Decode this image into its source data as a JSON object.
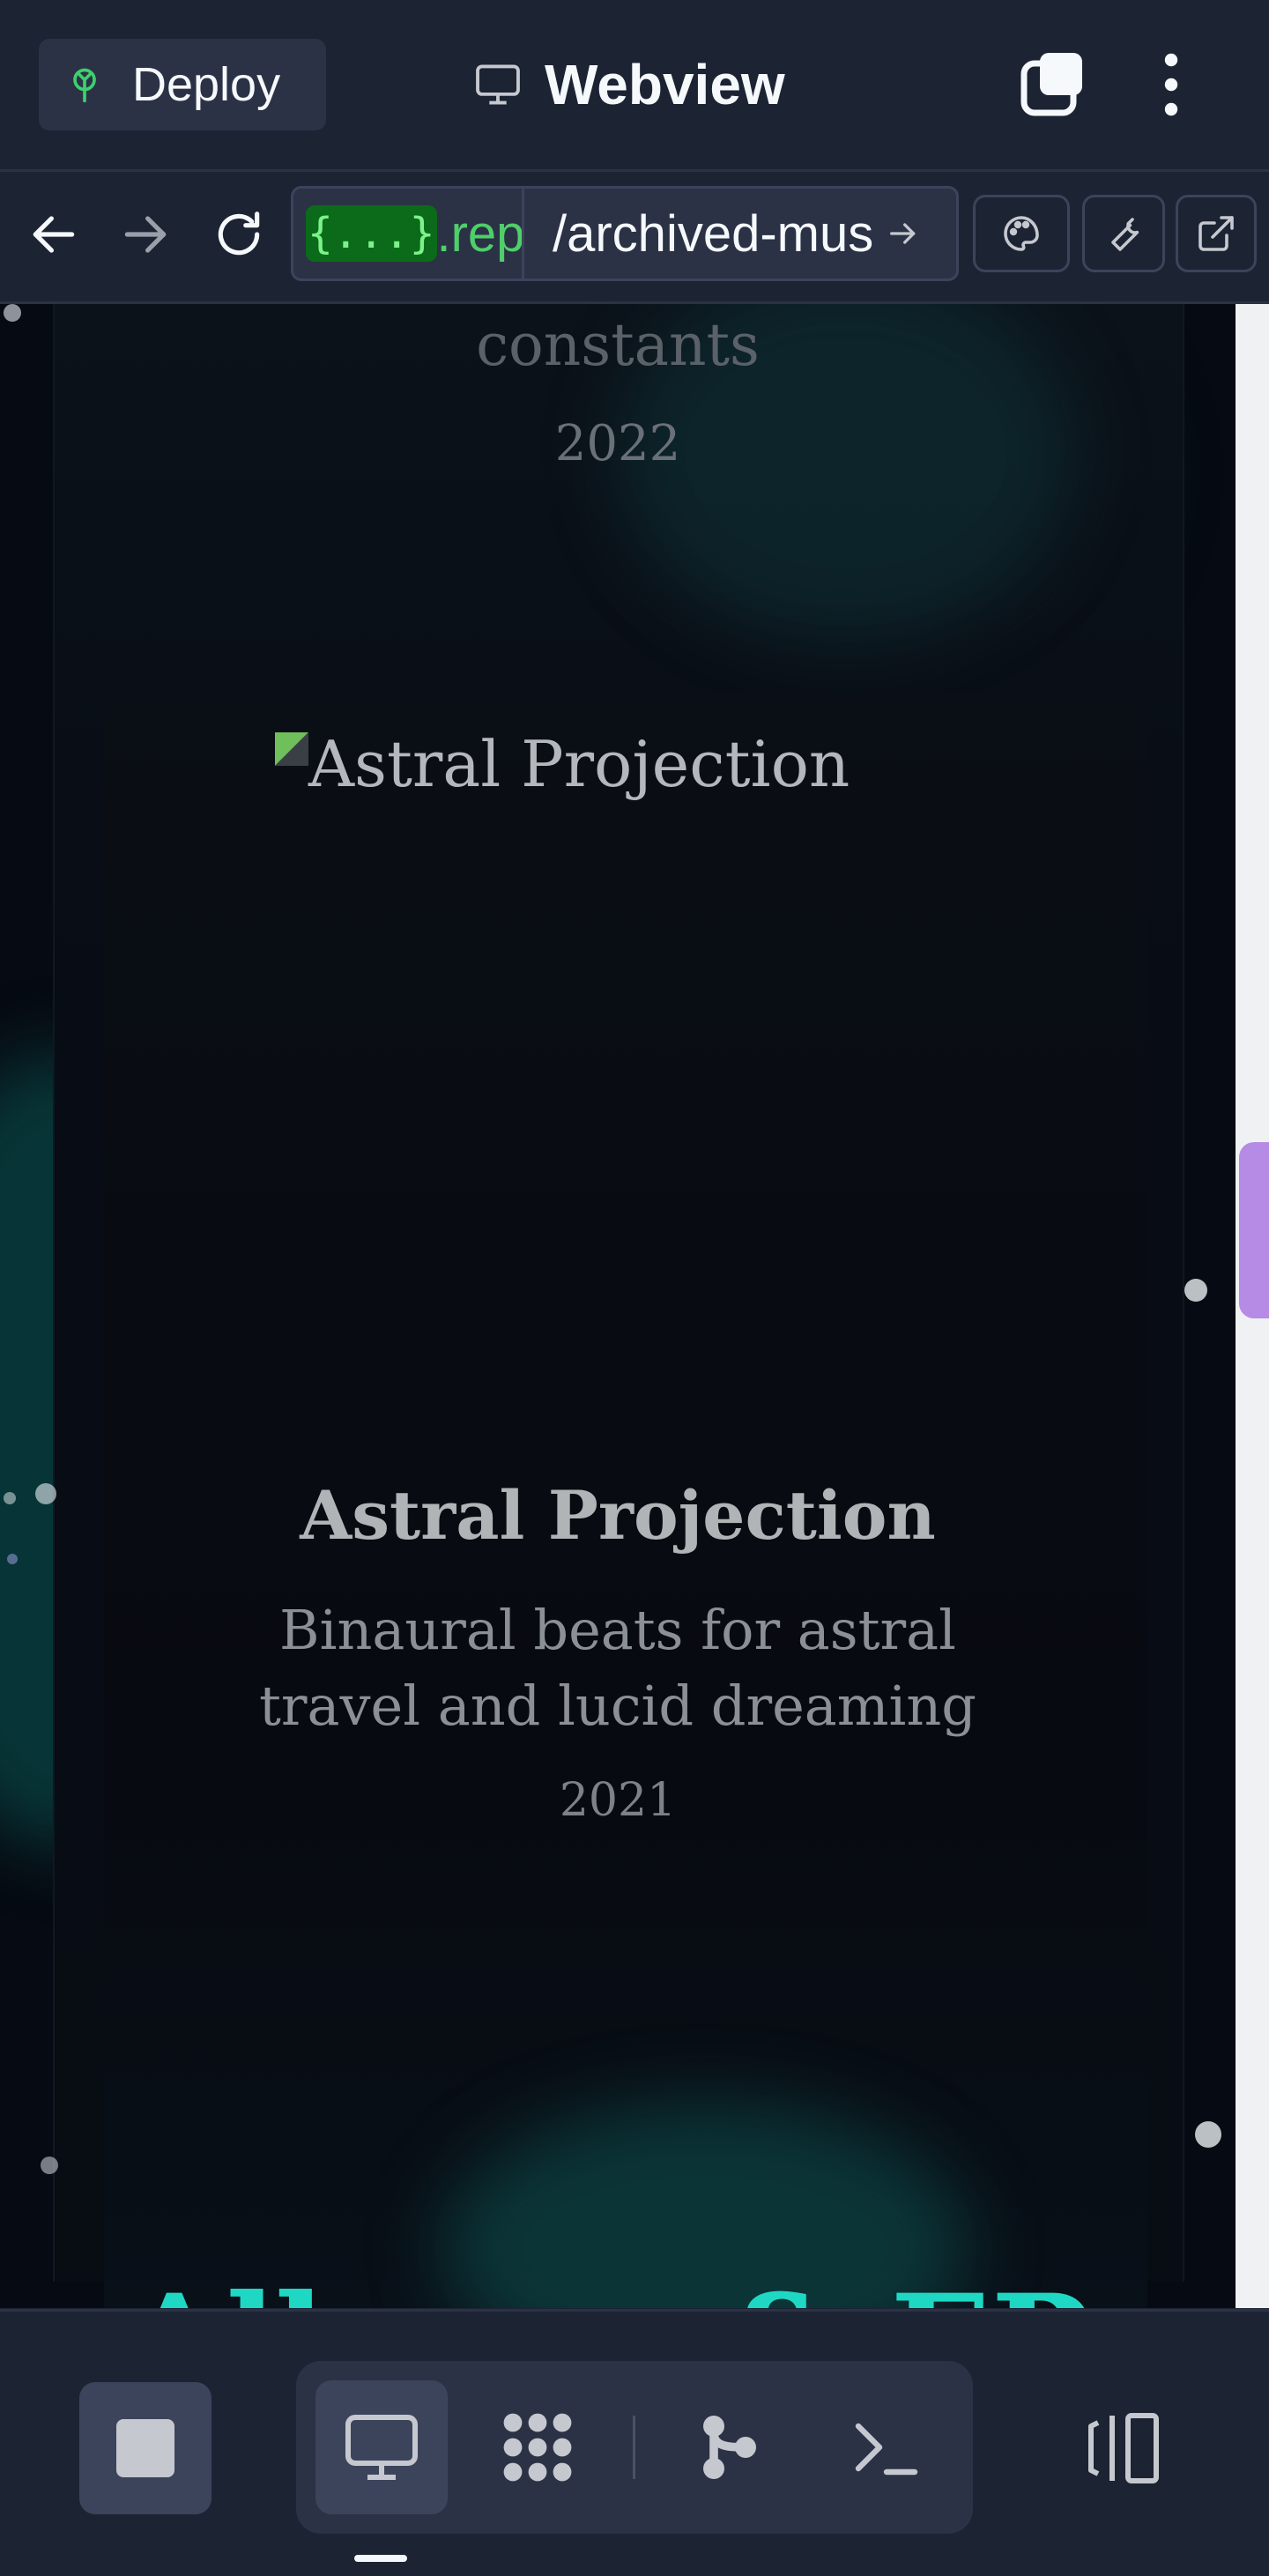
{
  "header": {
    "deploy_label": "Deploy",
    "title": "Webview"
  },
  "urlbar": {
    "badge": "{...}",
    "host": ".repl",
    "path": "/archived-mus"
  },
  "content": {
    "previous_item": {
      "title_fragment": "constants",
      "year": "2022"
    },
    "card": {
      "image_alt": "Astral Projection",
      "title": "Astral Projection",
      "description": "Binaural beats for astral travel and lucid dreaming",
      "year": "2021"
    },
    "next_section_heading": "Albums & EPs"
  },
  "colors": {
    "accent_teal": "#1ed8c4",
    "scroll_thumb": "#b58be6",
    "chrome_bg": "#1c2333"
  },
  "icons": [
    "deploy-icon",
    "monitor-icon",
    "tabs-icon",
    "kebab-icon",
    "back-icon",
    "forward-icon",
    "reload-icon",
    "palette-icon",
    "wrench-icon",
    "external-link-icon",
    "stop-icon",
    "webview-icon",
    "packager-icon",
    "git-icon",
    "shell-icon",
    "panels-icon"
  ]
}
